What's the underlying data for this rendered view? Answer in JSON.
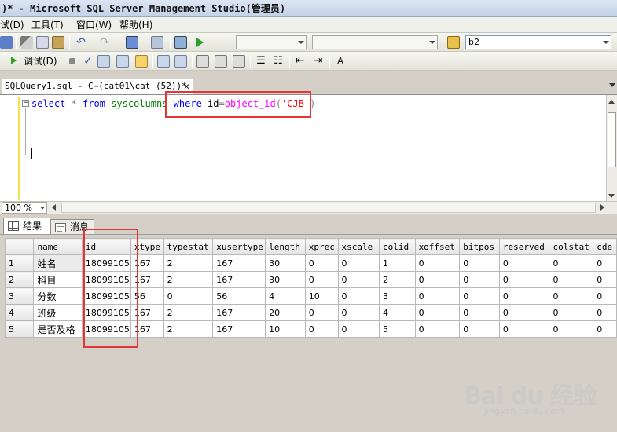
{
  "window": {
    "title": ")* - Microsoft SQL Server Management Studio(管理员)"
  },
  "menu": {
    "items": [
      "试(D)",
      "工具(T)",
      "窗口(W)",
      "帮助(H)"
    ]
  },
  "toolbar": {
    "database_value": "b2",
    "debug_label": "调试(D)"
  },
  "editor": {
    "tab_title": "SQLQuery1.sql - C⋯(cat01\\cat (52))*",
    "close_glyph": "×",
    "query": {
      "select": "select",
      "star": " * ",
      "from": "from",
      "table": "syscolumns",
      "where": "where",
      "col": "id",
      "eq": "=",
      "func": "object_id",
      "open": "(",
      "arg": "'CJB'",
      "close": ")"
    }
  },
  "zoom": {
    "value": "100 %"
  },
  "results": {
    "tabs": [
      {
        "label": "结果",
        "icon": "grid-icon",
        "active": true
      },
      {
        "label": "消息",
        "icon": "messages-icon",
        "active": false
      }
    ],
    "columns": [
      "name",
      "id",
      "xtype",
      "typestat",
      "xusertype",
      "length",
      "xprec",
      "xscale",
      "colid",
      "xoffset",
      "bitpos",
      "reserved",
      "colstat",
      "cde"
    ],
    "rows": [
      [
        "1",
        "姓名",
        "18099105",
        "167",
        "2",
        "167",
        "30",
        "0",
        "0",
        "1",
        "0",
        "0",
        "0",
        "0",
        "0"
      ],
      [
        "2",
        "科目",
        "18099105",
        "167",
        "2",
        "167",
        "30",
        "0",
        "0",
        "2",
        "0",
        "0",
        "0",
        "0",
        "0"
      ],
      [
        "3",
        "分数",
        "18099105",
        "56",
        "0",
        "56",
        "4",
        "10",
        "0",
        "3",
        "0",
        "0",
        "0",
        "0",
        "0"
      ],
      [
        "4",
        "班级",
        "18099105",
        "167",
        "2",
        "167",
        "20",
        "0",
        "0",
        "4",
        "0",
        "0",
        "0",
        "0",
        "0"
      ],
      [
        "5",
        "是否及格",
        "18099105",
        "167",
        "2",
        "167",
        "10",
        "0",
        "0",
        "5",
        "0",
        "0",
        "0",
        "0",
        "0"
      ]
    ]
  },
  "watermark": {
    "main": "Bai du 经验",
    "sub": "jingyan.baidu.com"
  },
  "colors": {
    "highlight_box": "#e53434",
    "keyword": "#0000ff",
    "system_table": "#008000",
    "function": "#ff00ff",
    "string": "#ff0000"
  }
}
